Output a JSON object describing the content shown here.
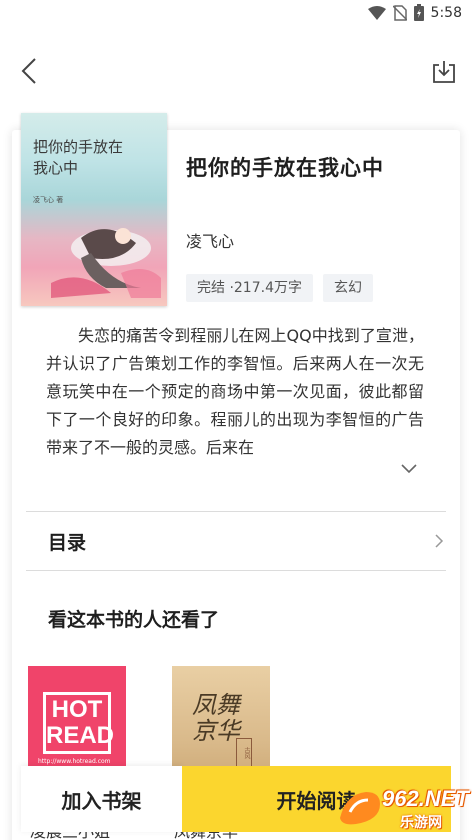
{
  "status_bar": {
    "time": "5:58"
  },
  "book": {
    "cover_title": "把你的手放在我心中",
    "cover_author": "凌飞心 著",
    "title": "把你的手放在我心中",
    "author": "凌飞心",
    "status_tag": "完结 ·217.4万字",
    "genre_tag": "玄幻",
    "description": "失恋的痛苦令到程丽儿在网上QQ中找到了宣泄，并认识了广告策划工作的李智恒。后来两人在一次无意玩笑中在一个预定的商场中第一次见面，彼此都留下了一个良好的印象。程丽儿的出现为李智恒的广告带来了不一般的灵感。后来在"
  },
  "toc": {
    "label": "目录"
  },
  "recommend": {
    "title": "看这本书的人还看了",
    "books": [
      {
        "cover_text_1": "HOT",
        "cover_text_2": "READ",
        "cover_url": "http://www.hotread.com",
        "name": "凌晨三小姐"
      },
      {
        "cover_text": "凤舞京华",
        "seal": "古风",
        "name": "凤舞京华"
      }
    ]
  },
  "actions": {
    "add_shelf": "加入书架",
    "start_read": "开始阅读"
  },
  "watermark": {
    "brand": "962.NET",
    "sub": "乐游网"
  },
  "colors": {
    "primary": "#fbd62e",
    "hot_read": "#f0446a",
    "tag_bg": "#f1f3f6"
  }
}
